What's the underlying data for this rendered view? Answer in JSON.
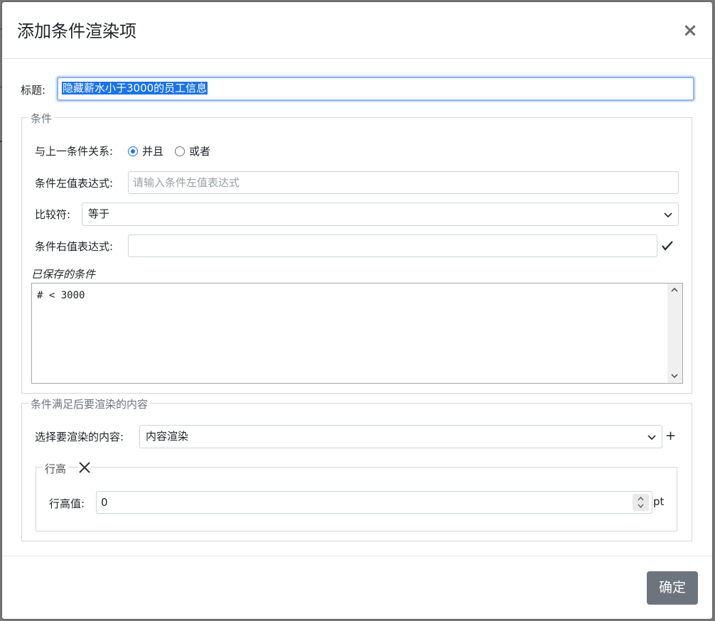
{
  "dialog": {
    "title": "添加条件渲染项",
    "close_symbol": "×"
  },
  "title_field": {
    "label": "标题:",
    "value": "隐藏薪水小于3000的员工信息"
  },
  "condition_group": {
    "legend": "条件",
    "relation_label": "与上一条件关系:",
    "relation_options": [
      {
        "label": "并且",
        "checked": true
      },
      {
        "label": "或者",
        "checked": false
      }
    ],
    "left_expr_label": "条件左值表达式:",
    "left_expr_placeholder": "请输入条件左值表达式",
    "left_expr_value": "",
    "comparator_label": "比较符:",
    "comparator_value": "等于",
    "right_expr_label": "条件右值表达式:",
    "right_expr_value": "",
    "saved_conditions_label": "已保存的条件",
    "saved_conditions_text": "# < 3000"
  },
  "render_group": {
    "legend": "条件满足后要渲染的内容",
    "select_label": "选择要渲染的内容:",
    "select_value": "内容渲染",
    "add_symbol": "+",
    "row_height": {
      "legend": "行高",
      "value_label": "行高值:",
      "value": "0",
      "unit": "pt"
    }
  },
  "footer": {
    "confirm_label": "确定"
  },
  "icons": {
    "close": "close-icon",
    "check": "check-icon",
    "chevron": "chevron-down-icon",
    "remove": "x-icon",
    "add": "plus-icon"
  },
  "colors": {
    "accent": "#1a73e8",
    "confirm_button": "#6c757d",
    "border": "#ced4da"
  }
}
